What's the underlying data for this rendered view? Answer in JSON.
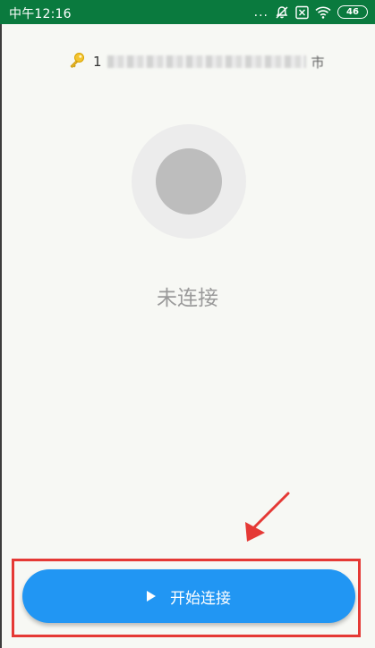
{
  "status_bar": {
    "time": "中午12:16",
    "dots": "...",
    "battery": "46"
  },
  "account": {
    "prefix": "1",
    "suffix": "市"
  },
  "connection": {
    "status_label": "未连接"
  },
  "primary_button": {
    "label": "开始连接"
  },
  "colors": {
    "status_bar_bg": "#0a7a3e",
    "button_bg": "#2196f3",
    "highlight": "#e53935"
  }
}
